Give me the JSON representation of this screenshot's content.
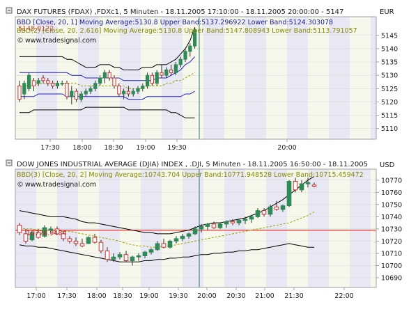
{
  "colors": {
    "frame": "#a0a0a0",
    "plot_bg": "#f6f8ec",
    "band_stripe": "#e8e8f4",
    "up_candle": "#2e8b57",
    "down_candle": "#d03030",
    "candle_wick": "#303030",
    "band_line": "#000000",
    "ma_line": "#a0a000",
    "band_line_blue": "#2020c0",
    "cursor_line": "#2e7a7a",
    "price_line": "#e00000",
    "text": "#202020",
    "legend_blue": "#1a1a90",
    "legend_olive": "#8a8a00"
  },
  "panels": [
    {
      "currency": "EUR",
      "title": "DAX FUTURES (FDAX) ,FDXc1, 5 Minuten - 18.11.2005 17:10:00 - 18.11.2005 20:00:00 - 5147",
      "legend_1": "BBD [Close, 20, 1] Moving Average:5130.8 Upper Band:5137.296922 Lower Band:5124.303078",
      "legend_2": "BBD(2) [Close, 20, 2.616] Moving Average:5130.8 Upper Band:5147.808943 Lower Band:5113.791057",
      "overlay_value": "5148.0122",
      "watermark": "www.tradesignal.com",
      "icon": "collapse-square-icon"
    },
    {
      "currency": "USD",
      "title": "DOW JONES INDUSTRIAL AVERAGE (DJIA) INDEX , .DJI, 5 Minuten - 18.11.2005 16:50:00 - 18.11.2005",
      "legend_1": "BBD(3) [Close, 20, 2] Moving Average:10743.704 Upper Band:10771.948528 Lower Band:10715.459472",
      "price_line_value": "10728.9434",
      "watermark": "www.tradesignal.com",
      "icon": "collapse-square-icon"
    }
  ],
  "chart_data": [
    {
      "type": "candlestick",
      "title": "DAX FUTURES (FDAX) ,FDXc1, 5 Minuten - 18.11.2005 17:10:00 - 18.11.2005 20:00:00 - 5147",
      "currency": "EUR",
      "ylim": [
        5106,
        5152
      ],
      "yticks": [
        5110,
        5115,
        5120,
        5125,
        5130,
        5135,
        5140,
        5145
      ],
      "x_tick_labels": [
        "17:30",
        "18:00",
        "18:30",
        "19:00",
        "19:30",
        "20:00"
      ],
      "bars": [
        {
          "o": 5126,
          "h": 5128,
          "l": 5120,
          "c": 5121
        },
        {
          "o": 5123,
          "h": 5128,
          "l": 5121,
          "c": 5127
        },
        {
          "o": 5125,
          "h": 5131,
          "l": 5124,
          "c": 5130
        },
        {
          "o": 5128,
          "h": 5129,
          "l": 5124,
          "c": 5126
        },
        {
          "o": 5127,
          "h": 5129,
          "l": 5126,
          "c": 5128
        },
        {
          "o": 5129,
          "h": 5130,
          "l": 5127,
          "c": 5128
        },
        {
          "o": 5128,
          "h": 5129,
          "l": 5126,
          "c": 5127
        },
        {
          "o": 5127,
          "h": 5128,
          "l": 5125,
          "c": 5126
        },
        {
          "o": 5126,
          "h": 5128,
          "l": 5125,
          "c": 5127
        },
        {
          "o": 5127,
          "h": 5128,
          "l": 5126,
          "c": 5127
        },
        {
          "o": 5127,
          "h": 5128,
          "l": 5121,
          "c": 5122
        },
        {
          "o": 5122,
          "h": 5126,
          "l": 5119,
          "c": 5124
        },
        {
          "o": 5124,
          "h": 5125,
          "l": 5120,
          "c": 5121
        },
        {
          "o": 5121,
          "h": 5124,
          "l": 5120,
          "c": 5123
        },
        {
          "o": 5123,
          "h": 5125,
          "l": 5122,
          "c": 5124
        },
        {
          "o": 5124,
          "h": 5126,
          "l": 5123,
          "c": 5125
        },
        {
          "o": 5125,
          "h": 5128,
          "l": 5124,
          "c": 5127
        },
        {
          "o": 5127,
          "h": 5130,
          "l": 5126,
          "c": 5129
        },
        {
          "o": 5129,
          "h": 5132,
          "l": 5127,
          "c": 5131
        },
        {
          "o": 5131,
          "h": 5132,
          "l": 5128,
          "c": 5129
        },
        {
          "o": 5129,
          "h": 5130,
          "l": 5125,
          "c": 5126
        },
        {
          "o": 5126,
          "h": 5127,
          "l": 5122,
          "c": 5123
        },
        {
          "o": 5123,
          "h": 5125,
          "l": 5121,
          "c": 5124
        },
        {
          "o": 5124,
          "h": 5126,
          "l": 5122,
          "c": 5123
        },
        {
          "o": 5123,
          "h": 5125,
          "l": 5122,
          "c": 5124
        },
        {
          "o": 5124,
          "h": 5126,
          "l": 5123,
          "c": 5125
        },
        {
          "o": 5125,
          "h": 5127,
          "l": 5124,
          "c": 5126
        },
        {
          "o": 5126,
          "h": 5131,
          "l": 5125,
          "c": 5130
        },
        {
          "o": 5130,
          "h": 5131,
          "l": 5126,
          "c": 5127
        },
        {
          "o": 5127,
          "h": 5132,
          "l": 5126,
          "c": 5131
        },
        {
          "o": 5131,
          "h": 5134,
          "l": 5129,
          "c": 5130
        },
        {
          "o": 5130,
          "h": 5133,
          "l": 5129,
          "c": 5132
        },
        {
          "o": 5132,
          "h": 5134,
          "l": 5130,
          "c": 5131
        },
        {
          "o": 5131,
          "h": 5135,
          "l": 5130,
          "c": 5134
        },
        {
          "o": 5134,
          "h": 5137,
          "l": 5133,
          "c": 5136
        },
        {
          "o": 5136,
          "h": 5140,
          "l": 5135,
          "c": 5139
        },
        {
          "o": 5139,
          "h": 5142,
          "l": 5137,
          "c": 5141
        },
        {
          "o": 5141,
          "h": 5148,
          "l": 5140,
          "c": 5147
        }
      ],
      "upper_band_2616": [
        5137,
        5137,
        5137,
        5137,
        5137,
        5137,
        5137,
        5137,
        5137,
        5137,
        5136,
        5136,
        5135,
        5134,
        5133,
        5133,
        5133,
        5134,
        5134,
        5134,
        5133,
        5133,
        5132,
        5132,
        5132,
        5132,
        5133,
        5133,
        5133,
        5134,
        5134,
        5134,
        5135,
        5136,
        5138,
        5140,
        5143,
        5148
      ],
      "upper_band_1": [
        5131,
        5131,
        5131,
        5131,
        5131,
        5131,
        5131,
        5131,
        5131,
        5131,
        5131,
        5130,
        5130,
        5130,
        5129,
        5129,
        5129,
        5129,
        5129,
        5129,
        5129,
        5129,
        5128,
        5128,
        5128,
        5128,
        5128,
        5128,
        5128,
        5129,
        5129,
        5129,
        5130,
        5131,
        5132,
        5134,
        5135,
        5137
      ],
      "moving_average": [
        5126,
        5126,
        5126,
        5126,
        5127,
        5127,
        5127,
        5127,
        5127,
        5127,
        5127,
        5127,
        5127,
        5126,
        5126,
        5126,
        5126,
        5126,
        5126,
        5126,
        5126,
        5126,
        5126,
        5125,
        5125,
        5125,
        5125,
        5126,
        5126,
        5126,
        5126,
        5127,
        5127,
        5128,
        5128,
        5129,
        5130,
        5131
      ],
      "lower_band_1": [
        5122,
        5122,
        5122,
        5122,
        5123,
        5123,
        5123,
        5123,
        5123,
        5123,
        5122,
        5122,
        5122,
        5122,
        5122,
        5122,
        5122,
        5122,
        5122,
        5122,
        5122,
        5122,
        5122,
        5121,
        5121,
        5121,
        5121,
        5122,
        5122,
        5122,
        5122,
        5122,
        5122,
        5122,
        5122,
        5123,
        5123,
        5124
      ],
      "lower_band_2616": [
        5116,
        5116,
        5116,
        5117,
        5117,
        5117,
        5117,
        5117,
        5117,
        5117,
        5117,
        5117,
        5117,
        5117,
        5118,
        5118,
        5118,
        5118,
        5118,
        5118,
        5118,
        5118,
        5118,
        5117,
        5117,
        5117,
        5117,
        5117,
        5117,
        5117,
        5117,
        5117,
        5116,
        5116,
        5115,
        5114,
        5114,
        5114
      ],
      "overlay_value": 5148.0122
    },
    {
      "type": "candlestick",
      "title": "DOW JONES INDUSTRIAL AVERAGE (DJIA) INDEX , .DJI, 5 Minuten - 18.11.2005 16:50:00 - 18.11.2005",
      "currency": "USD",
      "ylim": [
        10682,
        10779
      ],
      "yticks": [
        10690,
        10700,
        10710,
        10720,
        10730,
        10740,
        10750,
        10760,
        10770
      ],
      "x_tick_labels": [
        "17:00",
        "17:30",
        "18:00",
        "18:30",
        "19:00",
        "19:30",
        "20:00",
        "20:30",
        "21:00",
        "21:30",
        "22:00"
      ],
      "bars": [
        {
          "o": 10733,
          "h": 10735,
          "l": 10725,
          "c": 10727
        },
        {
          "o": 10726,
          "h": 10730,
          "l": 10718,
          "c": 10720
        },
        {
          "o": 10721,
          "h": 10728,
          "l": 10720,
          "c": 10727
        },
        {
          "o": 10727,
          "h": 10730,
          "l": 10722,
          "c": 10723
        },
        {
          "o": 10724,
          "h": 10733,
          "l": 10723,
          "c": 10731
        },
        {
          "o": 10729,
          "h": 10732,
          "l": 10726,
          "c": 10730
        },
        {
          "o": 10730,
          "h": 10732,
          "l": 10725,
          "c": 10726
        },
        {
          "o": 10726,
          "h": 10728,
          "l": 10720,
          "c": 10722
        },
        {
          "o": 10722,
          "h": 10724,
          "l": 10718,
          "c": 10720
        },
        {
          "o": 10720,
          "h": 10723,
          "l": 10716,
          "c": 10718
        },
        {
          "o": 10718,
          "h": 10722,
          "l": 10715,
          "c": 10716
        },
        {
          "o": 10718,
          "h": 10724,
          "l": 10718,
          "c": 10723
        },
        {
          "o": 10723,
          "h": 10726,
          "l": 10718,
          "c": 10719
        },
        {
          "o": 10719,
          "h": 10721,
          "l": 10710,
          "c": 10712
        },
        {
          "o": 10712,
          "h": 10715,
          "l": 10703,
          "c": 10705
        },
        {
          "o": 10705,
          "h": 10710,
          "l": 10703,
          "c": 10707
        },
        {
          "o": 10707,
          "h": 10711,
          "l": 10705,
          "c": 10709
        },
        {
          "o": 10709,
          "h": 10712,
          "l": 10703,
          "c": 10704
        },
        {
          "o": 10704,
          "h": 10708,
          "l": 10700,
          "c": 10707
        },
        {
          "o": 10707,
          "h": 10710,
          "l": 10704,
          "c": 10708
        },
        {
          "o": 10708,
          "h": 10712,
          "l": 10706,
          "c": 10711
        },
        {
          "o": 10711,
          "h": 10714,
          "l": 10709,
          "c": 10713
        },
        {
          "o": 10713,
          "h": 10720,
          "l": 10712,
          "c": 10718
        },
        {
          "o": 10718,
          "h": 10722,
          "l": 10714,
          "c": 10715
        },
        {
          "o": 10715,
          "h": 10721,
          "l": 10714,
          "c": 10720
        },
        {
          "o": 10720,
          "h": 10724,
          "l": 10718,
          "c": 10722
        },
        {
          "o": 10722,
          "h": 10726,
          "l": 10720,
          "c": 10724
        },
        {
          "o": 10724,
          "h": 10727,
          "l": 10722,
          "c": 10726
        },
        {
          "o": 10726,
          "h": 10732,
          "l": 10725,
          "c": 10730
        },
        {
          "o": 10730,
          "h": 10734,
          "l": 10727,
          "c": 10732
        },
        {
          "o": 10732,
          "h": 10735,
          "l": 10729,
          "c": 10734
        },
        {
          "o": 10734,
          "h": 10736,
          "l": 10730,
          "c": 10731
        },
        {
          "o": 10731,
          "h": 10735,
          "l": 10730,
          "c": 10734
        },
        {
          "o": 10734,
          "h": 10737,
          "l": 10731,
          "c": 10736
        },
        {
          "o": 10736,
          "h": 10738,
          "l": 10733,
          "c": 10735
        },
        {
          "o": 10735,
          "h": 10738,
          "l": 10733,
          "c": 10737
        },
        {
          "o": 10737,
          "h": 10740,
          "l": 10734,
          "c": 10738
        },
        {
          "o": 10738,
          "h": 10741,
          "l": 10735,
          "c": 10740
        },
        {
          "o": 10740,
          "h": 10747,
          "l": 10739,
          "c": 10745
        },
        {
          "o": 10745,
          "h": 10747,
          "l": 10740,
          "c": 10742
        },
        {
          "o": 10742,
          "h": 10750,
          "l": 10740,
          "c": 10748
        },
        {
          "o": 10748,
          "h": 10753,
          "l": 10745,
          "c": 10746
        },
        {
          "o": 10746,
          "h": 10750,
          "l": 10744,
          "c": 10749
        },
        {
          "o": 10749,
          "h": 10770,
          "l": 10748,
          "c": 10769
        },
        {
          "o": 10769,
          "h": 10772,
          "l": 10760,
          "c": 10762
        },
        {
          "o": 10762,
          "h": 10770,
          "l": 10760,
          "c": 10767
        },
        {
          "o": 10767,
          "h": 10772,
          "l": 10764,
          "c": 10768
        },
        {
          "o": 10766,
          "h": 10768,
          "l": 10764,
          "c": 10765
        }
      ],
      "upper_band": [
        10745,
        10744,
        10743,
        10742,
        10741,
        10740,
        10740,
        10740,
        10739,
        10738,
        10736,
        10735,
        10735,
        10734,
        10733,
        10732,
        10731,
        10730,
        10729,
        10728,
        10727,
        10727,
        10726,
        10726,
        10726,
        10727,
        10728,
        10729,
        10731,
        10733,
        10734,
        10735,
        10735,
        10736,
        10737,
        10738,
        10739,
        10741,
        10743,
        10745,
        10748,
        10751,
        10754,
        10758,
        10762,
        10766,
        10770,
        10773
      ],
      "moving_average": [
        10731,
        10730,
        10730,
        10729,
        10729,
        10729,
        10728,
        10728,
        10728,
        10727,
        10726,
        10725,
        10724,
        10723,
        10722,
        10721,
        10720,
        10718,
        10717,
        10716,
        10716,
        10715,
        10715,
        10716,
        10716,
        10717,
        10718,
        10719,
        10720,
        10721,
        10722,
        10723,
        10724,
        10725,
        10726,
        10727,
        10728,
        10729,
        10730,
        10731,
        10732,
        10733,
        10734,
        10735,
        10737,
        10739,
        10741,
        10744
      ],
      "lower_band": [
        10717,
        10716,
        10716,
        10715,
        10715,
        10714,
        10713,
        10712,
        10711,
        10710,
        10709,
        10708,
        10707,
        10706,
        10705,
        10704,
        10703,
        10703,
        10703,
        10703,
        10704,
        10704,
        10705,
        10705,
        10706,
        10706,
        10707,
        10707,
        10708,
        10709,
        10709,
        10710,
        10710,
        10711,
        10711,
        10712,
        10712,
        10713,
        10713,
        10714,
        10715,
        10716,
        10717,
        10718,
        10717,
        10716,
        10715,
        10715
      ],
      "price_line": 10728.9434
    }
  ]
}
